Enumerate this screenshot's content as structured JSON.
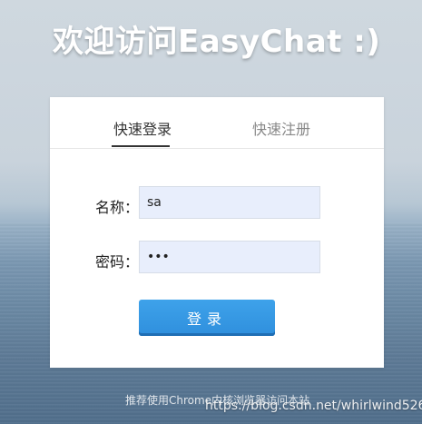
{
  "header": {
    "title": "欢迎访问EasyChat :)"
  },
  "tabs": [
    {
      "label": "快速登录",
      "active": true
    },
    {
      "label": "快速注册",
      "active": false
    }
  ],
  "form": {
    "name_label": "名称：",
    "name_value": "sa",
    "password_label": "密码：",
    "password_value": "•••",
    "submit_label": "登录"
  },
  "footer": {
    "hint": "推荐使用Chrome内核浏览器访问本站",
    "watermark": "https://blog.csdn.net/whirlwind526"
  },
  "colors": {
    "primary": "#2f8fdd",
    "input_bg": "#e8eefc"
  }
}
